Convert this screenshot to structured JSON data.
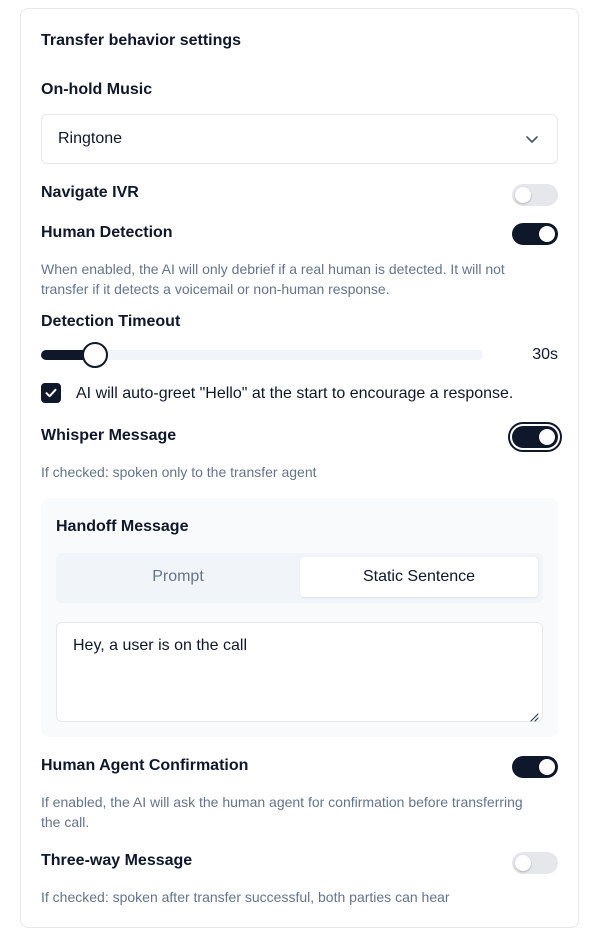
{
  "section": {
    "title": "Transfer behavior settings"
  },
  "on_hold_music": {
    "label": "On-hold Music",
    "selected": "Ringtone"
  },
  "navigate_ivr": {
    "label": "Navigate IVR",
    "enabled": false
  },
  "human_detection": {
    "label": "Human Detection",
    "enabled": true,
    "hint_line1": "When enabled, the AI will only debrief if a real human is detected. It will not",
    "hint_line2": "transfer if it detects a voicemail or non-human response."
  },
  "detection_timeout": {
    "label": "Detection Timeout",
    "value_text": "30s",
    "value_fraction": 0.12
  },
  "auto_greet": {
    "checked": true,
    "label": "AI will auto-greet \"Hello\" at the start to encourage a response."
  },
  "whisper_message": {
    "label": "Whisper Message",
    "enabled": true,
    "hint": "If checked: spoken only to the transfer agent"
  },
  "handoff_message": {
    "title": "Handoff Message",
    "tabs": [
      "Prompt",
      "Static Sentence"
    ],
    "active_tab": "Static Sentence",
    "text": "Hey, a user is on the call"
  },
  "human_agent_confirmation": {
    "label": "Human Agent Confirmation",
    "enabled": true,
    "hint_line1": "If enabled, the AI will ask the human agent for confirmation before transferring",
    "hint_line2": "the call."
  },
  "three_way_message": {
    "label": "Three-way Message",
    "enabled": false,
    "hint": "If checked: spoken after transfer successful, both parties can hear"
  },
  "colors": {
    "accent": "#0f172a",
    "muted_text": "#64748b",
    "toggle_off": "#e5e7eb"
  }
}
